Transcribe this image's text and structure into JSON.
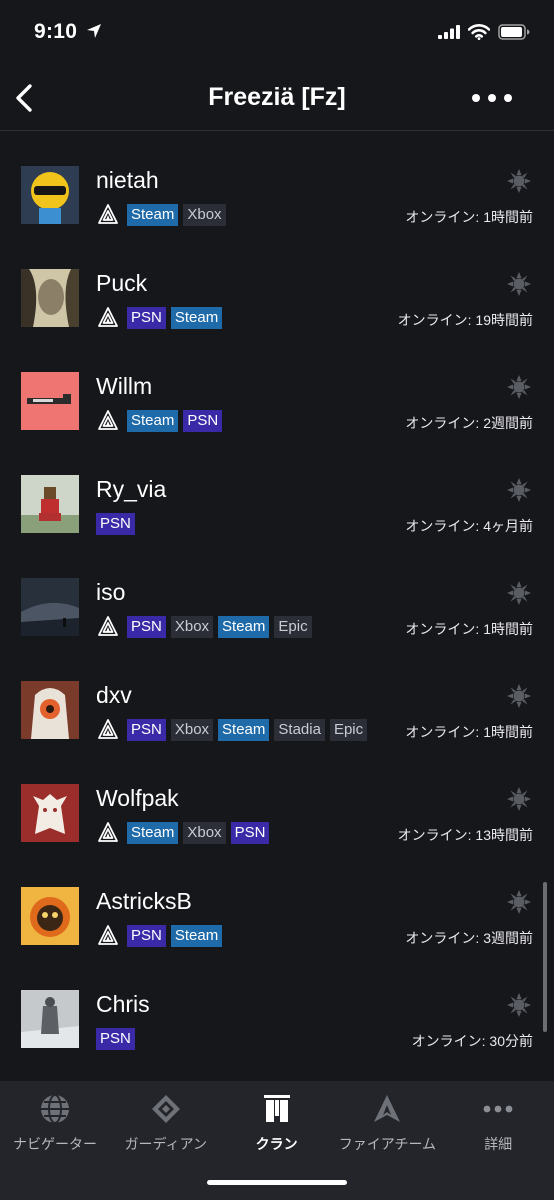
{
  "status_bar": {
    "time": "9:10",
    "icons": [
      "location-arrow-icon",
      "signal-icon",
      "wifi-icon",
      "battery-icon"
    ]
  },
  "header": {
    "title": "Freeziä [Fz]",
    "back_icon": "chevron-left-icon",
    "more_icon": "more-dots-icon"
  },
  "members": [
    {
      "name": "nietah",
      "platforms": [
        "Steam",
        "Xbox"
      ],
      "cross_save": true,
      "online": "オンライン: 1時間前",
      "avatar": "robot-helmet"
    },
    {
      "name": "Puck",
      "platforms": [
        "PSN",
        "Steam"
      ],
      "cross_save": true,
      "online": "オンライン: 19時間前",
      "avatar": "portrait-face"
    },
    {
      "name": "Willm",
      "platforms": [
        "Steam",
        "PSN"
      ],
      "cross_save": true,
      "online": "オンライン: 2週間前",
      "avatar": "rifle-on-pink"
    },
    {
      "name": "Ry_via",
      "platforms": [
        "PSN"
      ],
      "cross_save": false,
      "online": "オンライン: 4ヶ月前",
      "avatar": "pixel-character"
    },
    {
      "name": "iso",
      "platforms": [
        "PSN",
        "Xbox",
        "Steam",
        "Epic"
      ],
      "cross_save": true,
      "online": "オンライン: 1時間前",
      "avatar": "dark-landscape"
    },
    {
      "name": "dxv",
      "platforms": [
        "PSN",
        "Xbox",
        "Steam",
        "Stadia",
        "Epic"
      ],
      "cross_save": true,
      "online": "オンライン: 1時間前",
      "avatar": "hooded-robot"
    },
    {
      "name": "Wolfpak",
      "platforms": [
        "Steam",
        "Xbox",
        "PSN"
      ],
      "cross_save": true,
      "online": "オンライン: 13時間前",
      "avatar": "wolf-emblem"
    },
    {
      "name": "AstricksB",
      "platforms": [
        "PSN",
        "Steam"
      ],
      "cross_save": true,
      "online": "オンライン: 3週間前",
      "avatar": "fire-skull"
    },
    {
      "name": "Chris",
      "platforms": [
        "PSN"
      ],
      "cross_save": false,
      "online": "オンライン: 30分前",
      "avatar": "snow-figure"
    }
  ],
  "tabs": [
    {
      "label": "ナビゲーター",
      "icon": "navigator-globe-icon",
      "active": false
    },
    {
      "label": "ガーディアン",
      "icon": "guardian-diamond-icon",
      "active": false
    },
    {
      "label": "クラン",
      "icon": "clan-banner-icon",
      "active": true
    },
    {
      "label": "ファイアチーム",
      "icon": "fireteam-icon",
      "active": false
    },
    {
      "label": "詳細",
      "icon": "more-dots-icon",
      "active": false
    }
  ],
  "colors": {
    "background": "#16171b",
    "steam_badge": "#1f6aa8",
    "psn_badge": "#3a2aa8",
    "other_badge": "#2b2e36",
    "tabbar": "#23252b"
  }
}
